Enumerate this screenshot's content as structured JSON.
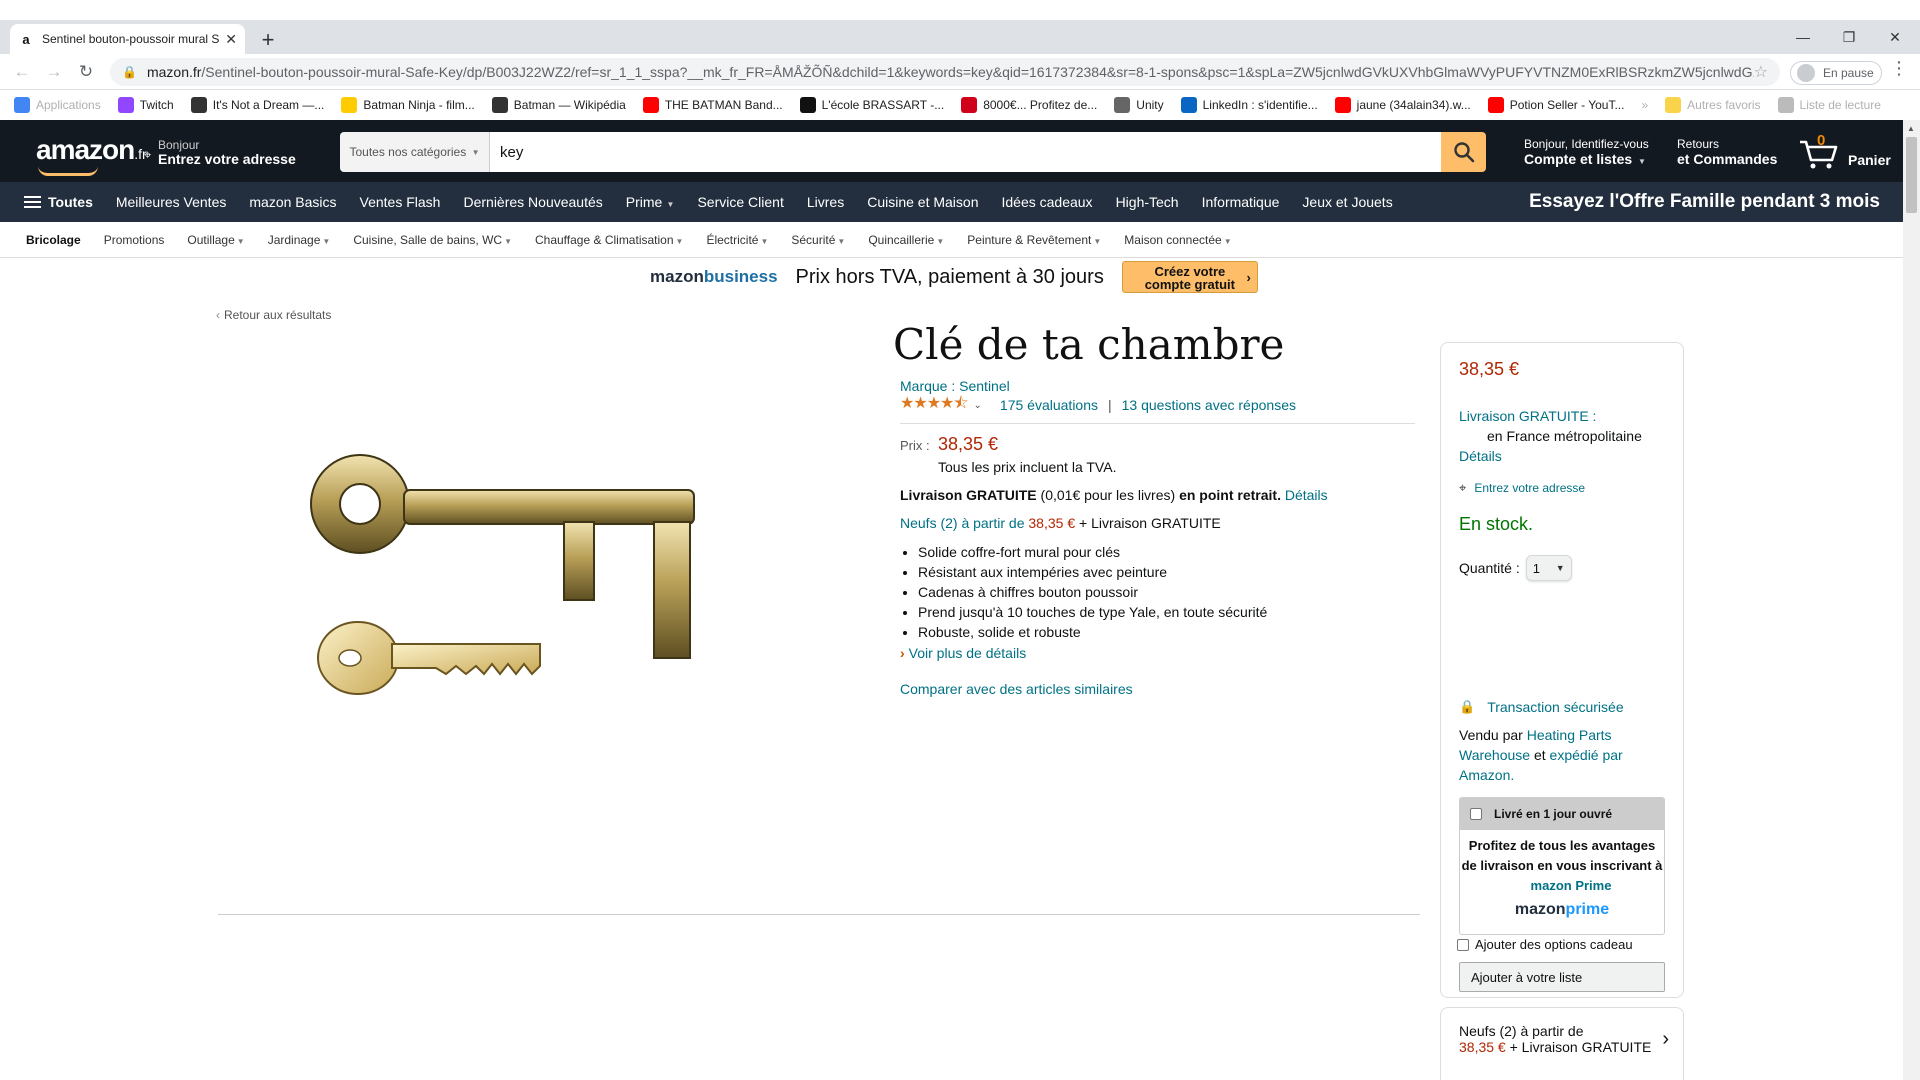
{
  "browser": {
    "tab_title": "Sentinel bouton-poussoir mural S",
    "tab_favicon": "a",
    "url_host": "mazon.fr",
    "url_rest": "/Sentinel-bouton-poussoir-mural-Safe-Key/dp/B003J22WZ2/ref=sr_1_1_sspa?__mk_fr_FR=ÅMÅŽÕÑ&dchild=1&keywords=key&qid=1617372384&sr=8-1-spons&psc=1&spLa=ZW5jcnlwdGVkUXVhbGlmaWVyPUFYVTNZM0ExRlBSRzkmZW5jcnlwdG...",
    "profile_label": "En pause",
    "bookmarks": [
      {
        "label": "Applications",
        "icon": "apps-grid",
        "color": "#4285f4",
        "faded": true
      },
      {
        "label": "Twitch",
        "icon": "twitch-icon",
        "color": "#9146ff"
      },
      {
        "label": "It's Not a Dream —...",
        "icon": "wikipedia-icon",
        "color": "#333333"
      },
      {
        "label": "Batman Ninja - film...",
        "icon": "allocine-icon",
        "color": "#fecc00"
      },
      {
        "label": "Batman — Wikipédia",
        "icon": "wikipedia-icon",
        "color": "#333333"
      },
      {
        "label": "THE BATMAN Band...",
        "icon": "youtube-icon",
        "color": "#ff0000"
      },
      {
        "label": "L'école BRASSART -...",
        "icon": "brassart-icon",
        "color": "#111111"
      },
      {
        "label": "8000€... Profitez de...",
        "icon": "uc-icon",
        "color": "#d0021b"
      },
      {
        "label": "Unity",
        "icon": "unity-icon",
        "color": "#666666"
      },
      {
        "label": "LinkedIn : s'identifie...",
        "icon": "linkedin-icon",
        "color": "#0a66c2"
      },
      {
        "label": "jaune (34alain34).w...",
        "icon": "youtube-icon",
        "color": "#ff0000"
      },
      {
        "label": "Potion Seller - YouT...",
        "icon": "youtube-icon",
        "color": "#ff0000"
      },
      {
        "label": "»",
        "icon": "",
        "color": "",
        "faded": true
      },
      {
        "label": "Autres favoris",
        "icon": "folder-icon",
        "color": "#f9d44b",
        "faded": true
      },
      {
        "label": "Liste de lecture",
        "icon": "reading-list-icon",
        "color": "#bbbbbb",
        "faded": true
      }
    ]
  },
  "header": {
    "logo_text": "amazon",
    "logo_tld": ".fr",
    "deliver_top": "Bonjour",
    "deliver_bottom": "Entrez votre adresse",
    "search_category": "Toutes nos catégories",
    "search_value": "key",
    "account_top": "Bonjour, Identifiez-vous",
    "account_bottom": "Compte et listes",
    "orders_top": "Retours",
    "orders_bottom": "et Commandes",
    "cart_count": "0",
    "cart_label": "Panier"
  },
  "nav": {
    "all_label": "Toutes",
    "items": [
      "Meilleures Ventes",
      "mazon Basics",
      "Ventes Flash",
      "Dernières Nouveautés",
      "Prime",
      "Service Client",
      "Livres",
      "Cuisine et Maison",
      "Idées cadeaux",
      "High-Tech",
      "Informatique",
      "Jeux et Jouets"
    ],
    "promo": "Essayez l'Offre Famille pendant 3 mois"
  },
  "subnav": {
    "items": [
      "Bricolage",
      "Promotions",
      "Outillage",
      "Jardinage",
      "Cuisine, Salle de bains, WC",
      "Chauffage & Climatisation",
      "Électricité",
      "Sécurité",
      "Quincaillerie",
      "Peinture & Revêtement",
      "Maison connectée"
    ]
  },
  "business": {
    "logo_a": "mazon",
    "logo_b": "business",
    "text": "Prix hors TVA, paiement à 30 jours",
    "btn_line1": "Créez votre",
    "btn_line2": "compte gratuit"
  },
  "product": {
    "back": "Retour aux résultats",
    "title": "Clé de ta chambre",
    "brand": "Marque : Sentinel",
    "rating_value": 4.5,
    "ratings_count": "175 évaluations",
    "questions": "13 questions avec réponses",
    "price_label": "Prix :",
    "price": "38,35 €",
    "tva": "Tous les prix incluent la TVA.",
    "delivery_bold": "Livraison GRATUITE",
    "delivery_mid": "(0,01€ pour les livres)",
    "delivery_bold2": "en point retrait.",
    "delivery_link": "Détails",
    "neufs_link": "Neufs (2) à partir de",
    "neufs_price": "38,35 €",
    "neufs_tail": "+ Livraison GRATUITE",
    "bullets": [
      "Solide coffre-fort mural pour clés",
      "Résistant aux intempéries avec peinture",
      "Cadenas à chiffres bouton poussoir",
      "Prend jusqu'à 10 touches de type Yale, en toute sécurité",
      "Robuste, solide et robuste"
    ],
    "more": "Voir plus de détails",
    "compare": "Comparer avec des articles similaires"
  },
  "buybox": {
    "price": "38,35 €",
    "free": "Livraison GRATUITE :",
    "region": "en France métropolitaine",
    "details": "Détails",
    "address": "Entrez votre adresse",
    "stock": "En stock.",
    "qty_label": "Quantité :",
    "qty_value": "1",
    "secure": "Transaction sécurisée",
    "sold_by": "Vendu par",
    "seller": "Heating Parts Warehouse",
    "and": "et",
    "shipped": "expédié par Amazon.",
    "prime_head": "Livré en 1 jour ouvré",
    "prime_body": "Profitez de tous les avantages de livraison en vous inscrivant à",
    "prime_link": "mazon Prime",
    "prime_logo_a": "mazon",
    "prime_logo_b": "prime",
    "gift": "Ajouter des options cadeau",
    "list": "Ajouter à votre liste"
  },
  "offers": {
    "line1": "Neufs (2) à partir de",
    "price": "38,35 €",
    "tail": "+ Livraison GRATUITE"
  }
}
